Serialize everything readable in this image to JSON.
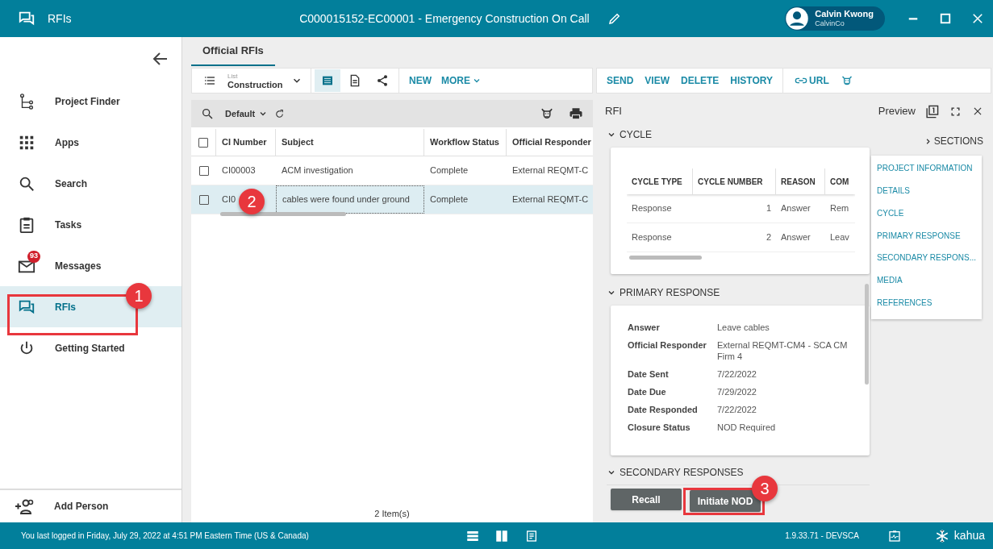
{
  "window": {
    "app_title": "RFIs",
    "document_title": "C000015152-EC00001 - Emergency Construction On Call",
    "user": {
      "name": "Calvin Kwong",
      "company": "CalvinCo"
    }
  },
  "sidebar": {
    "items": [
      {
        "label": "Project Finder",
        "selected": false
      },
      {
        "label": "Apps",
        "selected": false
      },
      {
        "label": "Search",
        "selected": false
      },
      {
        "label": "Tasks",
        "selected": false
      },
      {
        "label": "Messages",
        "selected": false,
        "badge": "93"
      },
      {
        "label": "RFIs",
        "selected": true
      },
      {
        "label": "Getting Started",
        "selected": false
      }
    ],
    "footer_item": {
      "label": "Add Person"
    }
  },
  "tabs": [
    {
      "label": "Official RFIs",
      "selected": true
    }
  ],
  "toolbar": {
    "list_caption": "List",
    "list_name": "Construction",
    "views": [
      {
        "selected": true
      },
      {
        "selected": false
      },
      {
        "selected": false
      }
    ],
    "actions": [
      "NEW",
      "MORE"
    ],
    "detail_actions": [
      "SEND",
      "VIEW",
      "DELETE",
      "HISTORY"
    ],
    "url_label": "URL"
  },
  "grid": {
    "view": "Default",
    "select_all_checked": false,
    "columns": [
      "CI Number",
      "Subject",
      "Workflow Status",
      "Official Responder"
    ],
    "rows": [
      {
        "checked": false,
        "selected": false,
        "cells": [
          "CI00003",
          "ACM investigation",
          "Complete",
          "External REQMT-C"
        ]
      },
      {
        "checked": false,
        "selected": true,
        "cells": [
          "CI0",
          "cables were found under ground",
          "Complete",
          "External REQMT-C"
        ]
      }
    ],
    "footer": "2 Item(s)"
  },
  "detail": {
    "title": "RFI",
    "preview_label": "Preview",
    "cycle": {
      "title": "CYCLE",
      "columns": [
        "CYCLE TYPE",
        "CYCLE NUMBER",
        "REASON",
        "COM"
      ],
      "rows": [
        [
          "Response",
          "1",
          "Answer",
          "Rem"
        ],
        [
          "Response",
          "2",
          "Answer",
          "Leav"
        ]
      ]
    },
    "primary": {
      "title": "PRIMARY RESPONSE",
      "fields": [
        {
          "label": "Answer",
          "value": "Leave cables"
        },
        {
          "label": "Official Responder",
          "value": "External REQMT-CM4 - SCA CM Firm 4"
        },
        {
          "label": "Date Sent",
          "value": "7/22/2022"
        },
        {
          "label": "Date Due",
          "value": "7/29/2022"
        },
        {
          "label": "Date Responded",
          "value": "7/22/2022"
        },
        {
          "label": "Closure Status",
          "value": "NOD Required"
        }
      ]
    },
    "secondary": {
      "title": "SECONDARY RESPONSES"
    },
    "buttons": [
      "Recall",
      "Initiate NOD"
    ]
  },
  "sections_nav": {
    "title": "SECTIONS",
    "items": [
      "PROJECT INFORMATION",
      "DETAILS",
      "CYCLE",
      "PRIMARY RESPONSE",
      "SECONDARY RESPONS...",
      "MEDIA",
      "REFERENCES"
    ]
  },
  "status_bar": {
    "message": "You last logged in Friday, July 29, 2022 at 4:51 PM Eastern Time (US & Canada)",
    "version": "1.9.33.71 - DEVSCA",
    "logo": "kahua"
  },
  "callouts": [
    {
      "number": "1",
      "boxed": true
    },
    {
      "number": "2",
      "boxed": false
    },
    {
      "number": "3",
      "boxed": true
    }
  ]
}
